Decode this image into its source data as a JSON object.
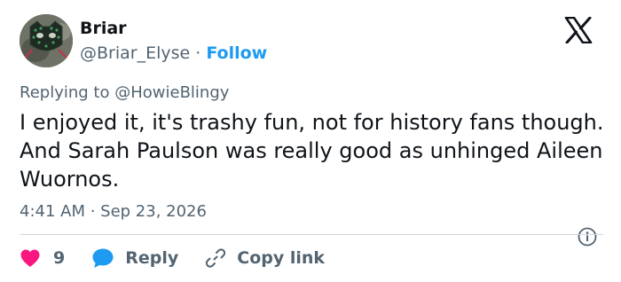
{
  "author": {
    "display_name": "Briar",
    "handle": "@Briar_Elyse",
    "separator": "·",
    "follow_label": "Follow",
    "avatar_icon": "avatar-cat-icon"
  },
  "platform": {
    "logo_icon": "x-logo-icon"
  },
  "reply_context": {
    "prefix": "Replying to",
    "mention": "@HowieBlingy"
  },
  "tweet": {
    "text": "I enjoyed it, it's trashy fun, not for history fans though. And Sarah Paulson was really good as unhinged Aileen Wuornos.",
    "timestamp": "4:41 AM · Sep 23, 2026",
    "info_icon": "info-icon"
  },
  "actions": {
    "like_count": "9",
    "reply_label": "Reply",
    "copy_link_label": "Copy link",
    "like_icon": "heart-icon",
    "reply_icon": "reply-bubble-icon",
    "copy_icon": "link-icon"
  },
  "colors": {
    "accent": "#1d9bf0",
    "like": "#f91880",
    "muted_text": "#536471",
    "primary_text": "#0f1419",
    "divider": "#cfd9de"
  }
}
